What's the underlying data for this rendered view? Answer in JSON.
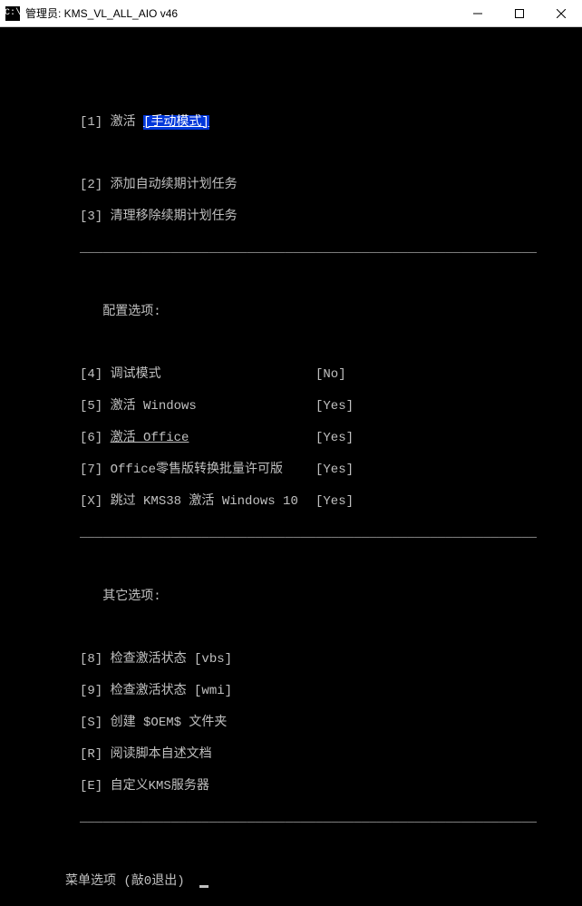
{
  "window": {
    "icon_text": "C:\\",
    "title": "管理员:  KMS_VL_ALL_AIO v46"
  },
  "menu": {
    "item1": {
      "key": "[1]",
      "label": "激活",
      "mode": "[手动模式]"
    },
    "item2": {
      "key": "[2]",
      "label": "添加自动续期计划任务"
    },
    "item3": {
      "key": "[3]",
      "label": "清理移除续期计划任务"
    }
  },
  "config": {
    "header": "配置选项:",
    "item4": {
      "key": "[4]",
      "label": "调试模式",
      "value": "[No]"
    },
    "item5": {
      "key": "[5]",
      "label": "激活 Windows",
      "value": "[Yes]"
    },
    "item6": {
      "key": "[6]",
      "label": "激活 Office",
      "value": "[Yes]"
    },
    "item7": {
      "key": "[7]",
      "label": "Office零售版转换批量许可版",
      "value": "[Yes]"
    },
    "itemX": {
      "key": "[X]",
      "label": "跳过 KMS38 激活 Windows 10",
      "value": "[Yes]"
    }
  },
  "other": {
    "header": "其它选项:",
    "item8": {
      "key": "[8]",
      "label": "检查激活状态 [vbs]"
    },
    "item9": {
      "key": "[9]",
      "label": "检查激活状态 [wmi]"
    },
    "itemS": {
      "key": "[S]",
      "label": "创建 $OEM$ 文件夹"
    },
    "itemR": {
      "key": "[R]",
      "label": "阅读脚本自述文档"
    },
    "itemE": {
      "key": "[E]",
      "label": "自定义KMS服务器"
    }
  },
  "prompt": "菜单选项 (敲0退出) "
}
